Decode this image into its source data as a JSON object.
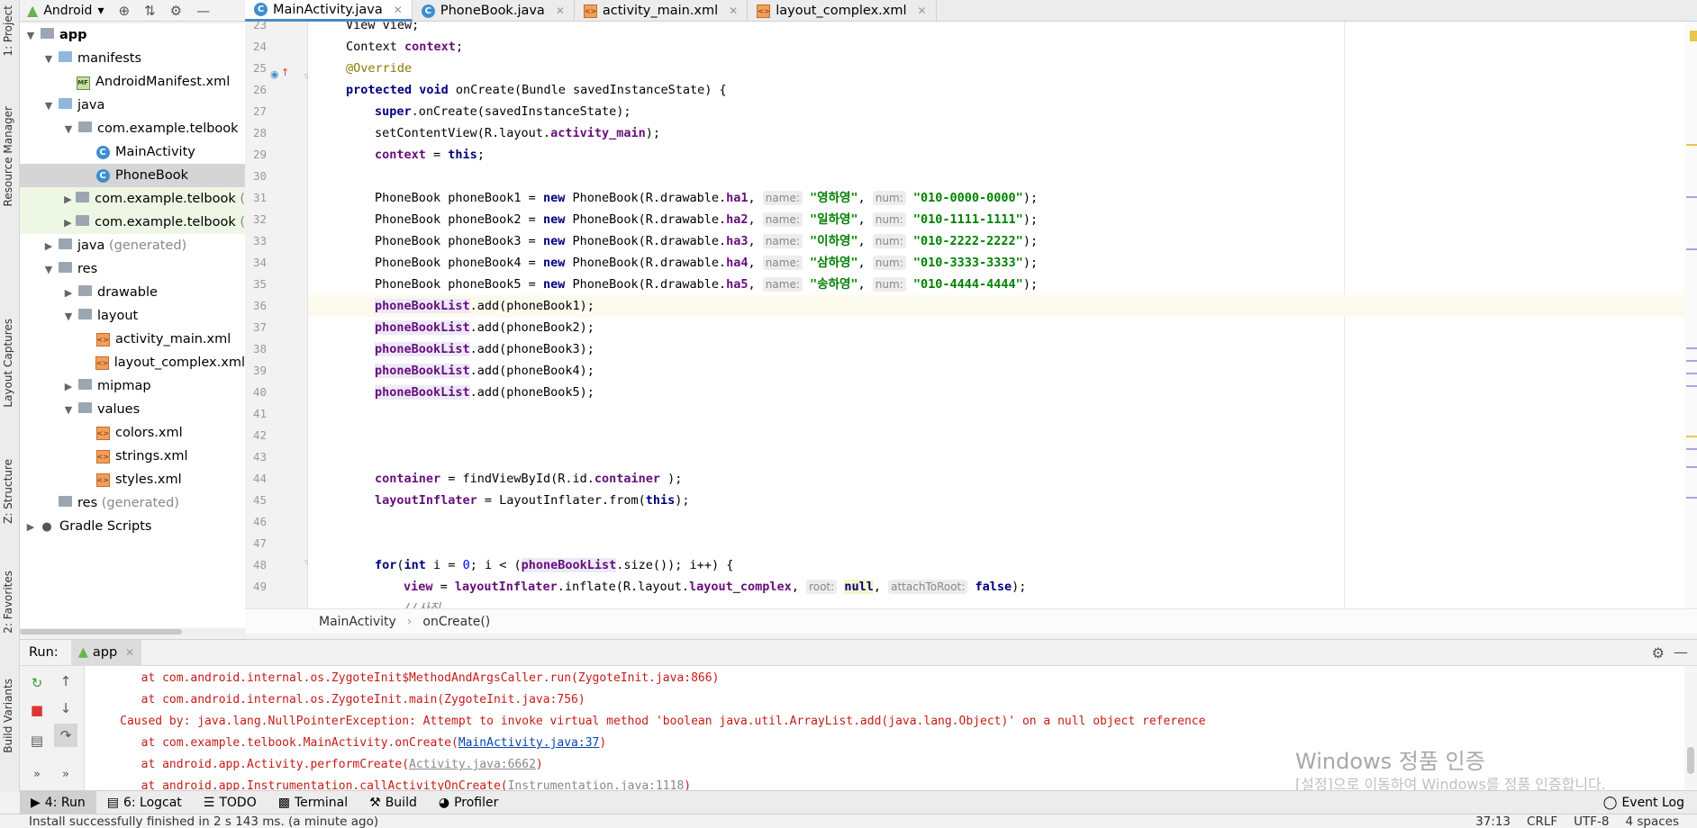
{
  "project": {
    "view_label": "Android",
    "tree": [
      {
        "label": "app",
        "bold": true
      },
      {
        "label": "manifests"
      },
      {
        "label": "AndroidManifest.xml"
      },
      {
        "label": "java"
      },
      {
        "label": "com.example.telbook"
      },
      {
        "label": "MainActivity"
      },
      {
        "label": "PhoneBook"
      },
      {
        "label": "com.example.telbook",
        "suffix": "("
      },
      {
        "label": "com.example.telbook",
        "suffix": "("
      },
      {
        "label": "java",
        "suffix": "(generated)"
      },
      {
        "label": "res"
      },
      {
        "label": "drawable"
      },
      {
        "label": "layout"
      },
      {
        "label": "activity_main.xml"
      },
      {
        "label": "layout_complex.xml"
      },
      {
        "label": "mipmap"
      },
      {
        "label": "values"
      },
      {
        "label": "colors.xml"
      },
      {
        "label": "strings.xml"
      },
      {
        "label": "styles.xml"
      },
      {
        "label": "res",
        "suffix": "(generated)"
      },
      {
        "label": "Gradle Scripts"
      }
    ]
  },
  "left_strip": {
    "project": "1: Project",
    "resource_manager": "Resource Manager",
    "layout_captures": "Layout Captures",
    "structure": "Z: Structure",
    "favorites": "2: Favorites",
    "build_variants": "Build Variants"
  },
  "tabs": [
    {
      "label": "MainActivity.java",
      "active": true,
      "icon": "class-icon"
    },
    {
      "label": "PhoneBook.java",
      "active": false,
      "icon": "class-icon"
    },
    {
      "label": "activity_main.xml",
      "active": false,
      "icon": "xml-icon"
    },
    {
      "label": "layout_complex.xml",
      "active": false,
      "icon": "xml-icon"
    }
  ],
  "editor": {
    "line_numbers": [
      "23",
      "24",
      "25",
      "26",
      "27",
      "28",
      "29",
      "30",
      "31",
      "32",
      "33",
      "34",
      "35",
      "36",
      "37",
      "38",
      "39",
      "40",
      "41",
      "42",
      "43",
      "44",
      "45",
      "46",
      "47",
      "48",
      "49"
    ],
    "code": {
      "l23": "View view;",
      "l24a": "Context ",
      "l24b": "context",
      "l24c": ";",
      "l25": "@Override",
      "l26a": "protected void",
      "l26b": " onCreate(Bundle savedInstanceState) {",
      "l27a": "super",
      "l27b": ".onCreate(savedInstanceState);",
      "l28a": "setContentView(R.layout.",
      "l28b": "activity_main",
      "l28c": ");",
      "l29a": "context",
      "l29b": " = ",
      "l29c": "this",
      "l29d": ";",
      "pb_lines": [
        {
          "decl": "PhoneBook phoneBook1 = ",
          "draw": "ha1",
          "name": "\"영하영\"",
          "num": "\"010-0000-0000\""
        },
        {
          "decl": "PhoneBook phoneBook2 = ",
          "draw": "ha2",
          "name": "\"일하영\"",
          "num": "\"010-1111-1111\""
        },
        {
          "decl": "PhoneBook phoneBook3 = ",
          "draw": "ha3",
          "name": "\"이하영\"",
          "num": "\"010-2222-2222\""
        },
        {
          "decl": "PhoneBook phoneBook4 = ",
          "draw": "ha4",
          "name": "\"삼하영\"",
          "num": "\"010-3333-3333\""
        },
        {
          "decl": "PhoneBook phoneBook5 = ",
          "draw": "ha5",
          "name": "\"송하영\"",
          "num": "\"010-4444-4444\""
        }
      ],
      "kw_new": "new",
      "pb_ctor": " PhoneBook(R.drawable.",
      "hint_name": "name:",
      "hint_num": "num:",
      "add_lines": [
        {
          "field": "phoneBookList",
          "call": ".add(phoneBook1);"
        },
        {
          "field": "phoneBookList",
          "call": ".add(phoneBook2);"
        },
        {
          "field": "phoneBookList",
          "call": ".add(phoneBook3);"
        },
        {
          "field": "phoneBookList",
          "call": ".add(phoneBook4);"
        },
        {
          "field": "phoneBookList",
          "call": ".add(phoneBook5);"
        }
      ],
      "l43a": "container",
      "l43b": " = findViewById(R.id.",
      "l43c": "container",
      "l43d": " );",
      "l44a": "layoutInflater",
      "l44b": " = LayoutInflater.from(",
      "l44c": "this",
      "l44d": ");",
      "l47a": "for",
      "l47b": "(",
      "l47c": "int",
      "l47d": " i = ",
      "l47e": "0",
      "l47f": "; i < (",
      "l47g": "phoneBookList",
      "l47h": ".size()); i++) {",
      "l48a": "view",
      "l48b": " = ",
      "l48c": "layoutInflater",
      "l48d": ".inflate(R.layout.",
      "l48e": "layout_complex",
      "l48f": ", ",
      "l48hint1": "root:",
      "l48g": "null",
      "l48h": ", ",
      "l48hint2": "attachToRoot:",
      "l48i": "false",
      "l48j": ");",
      "l49": "//사진"
    }
  },
  "breadcrumb": {
    "class": "MainActivity",
    "method": "onCreate()"
  },
  "run": {
    "label": "Run:",
    "config": "app",
    "console": [
      "        at com.android.internal.os.ZygoteInit$MethodAndArgsCaller.run(ZygoteInit.java:866)",
      "        at com.android.internal.os.ZygoteInit.main(ZygoteInit.java:756)",
      "     Caused by: java.lang.NullPointerException: Attempt to invoke virtual method 'boolean java.util.ArrayList.add(java.lang.Object)' on a null object reference"
    ],
    "line4_prefix": "        at com.example.telbook.MainActivity.onCreate(",
    "line4_link": "MainActivity.java:37",
    "line4_suffix": ")",
    "line5_prefix": "        at android.app.Activity.performCreate(",
    "line5_link": "Activity.java:6662",
    "line5_suffix": ")",
    "line6_prefix": "        at android.app.Instrumentation.callActivityOnCreate(",
    "line6_link": "Instrumentation.java:1118",
    "line6_suffix": ")"
  },
  "watermark": {
    "title": "Windows 정품 인증",
    "subtitle": "[설정]으로 이동하여 Windows를 정품 인증합니다."
  },
  "bottom_tools": {
    "run": "4: Run",
    "logcat": "6: Logcat",
    "todo": "TODO",
    "terminal": "Terminal",
    "build": "Build",
    "profiler": "Profiler",
    "event_log": "Event Log"
  },
  "status": {
    "message": "Install successfully finished in 2 s 143 ms. (a minute ago)",
    "position": "37:13",
    "line_sep": "CRLF",
    "encoding": "UTF-8",
    "indent": "4 spaces"
  }
}
